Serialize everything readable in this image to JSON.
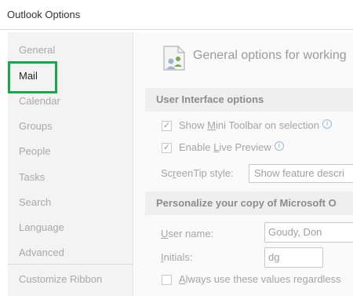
{
  "window": {
    "title": "Outlook Options"
  },
  "sidebar": {
    "items": [
      {
        "label": "General"
      },
      {
        "label": "Mail"
      },
      {
        "label": "Calendar"
      },
      {
        "label": "Groups"
      },
      {
        "label": "People"
      },
      {
        "label": "Tasks"
      },
      {
        "label": "Search"
      },
      {
        "label": "Language"
      },
      {
        "label": "Advanced"
      },
      {
        "label": "Customize Ribbon"
      }
    ],
    "active": "Mail",
    "highlight_color": "#18a849"
  },
  "main": {
    "header": {
      "icon": "general-options-icon",
      "title": "General options for working"
    },
    "ui_options": {
      "section_title": "User Interface options",
      "mini_toolbar": {
        "pre": "Show ",
        "accel": "M",
        "post": "ini Toolbar on selection",
        "checked": true
      },
      "live_preview": {
        "pre": "Enable ",
        "accel": "L",
        "post": "ive Preview",
        "checked": true
      },
      "screentip": {
        "pre": "Sc",
        "accel": "r",
        "post": "eenTip style:",
        "value": "Show feature descri"
      }
    },
    "personalize": {
      "section_title": "Personalize your copy of Microsoft O",
      "user_name": {
        "pre": "",
        "accel": "U",
        "post": "ser name:",
        "value": "Goudy, Don"
      },
      "initials": {
        "pre": "",
        "accel": "I",
        "post": "nitials:",
        "value": "dg"
      },
      "always_use": {
        "pre": "",
        "accel": "A",
        "post": "lways use these values regardless",
        "checked": false
      }
    },
    "info_glyph": "i"
  }
}
